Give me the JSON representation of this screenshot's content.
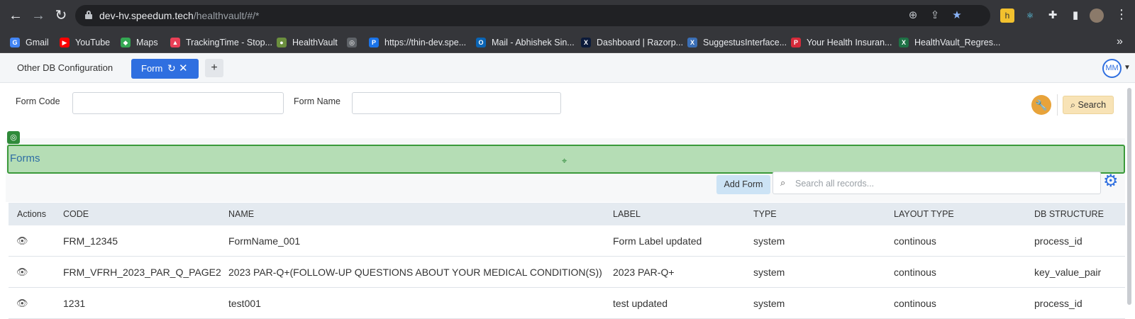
{
  "browser": {
    "url_host": "dev-hv.speedum.tech",
    "url_path": "/healthvault/#/*",
    "bookmarks": [
      {
        "label": "Gmail",
        "color": "#4285f4",
        "glyph": "G"
      },
      {
        "label": "YouTube",
        "color": "#ff0000",
        "glyph": "▶"
      },
      {
        "label": "Maps",
        "color": "#34a853",
        "glyph": "◆"
      },
      {
        "label": "TrackingTime - Stop...",
        "color": "#e94057",
        "glyph": "▲"
      },
      {
        "label": "HealthVault",
        "color": "#6b8f3e",
        "glyph": "●"
      },
      {
        "label": "",
        "color": "#5f6368",
        "glyph": "◎"
      },
      {
        "label": "https://thin-dev.spe...",
        "color": "#1a73e8",
        "glyph": "P"
      },
      {
        "label": "Mail - Abhishek Sin...",
        "color": "#0a64b4",
        "glyph": "O"
      },
      {
        "label": "Dashboard | Razorp...",
        "color": "#0b1a3a",
        "glyph": "X"
      },
      {
        "label": "SuggestusInterface...",
        "color": "#3b6fb6",
        "glyph": "X"
      },
      {
        "label": "Your Health Insuran...",
        "color": "#d62b3a",
        "glyph": "P"
      },
      {
        "label": "HealthVault_Regres...",
        "color": "#1e7145",
        "glyph": "X"
      }
    ]
  },
  "header": {
    "tab_other": "Other DB Configuration",
    "tab_active": "Form",
    "add_tab": "+",
    "avatar_initials": "MM"
  },
  "filters": {
    "form_code_label": "Form Code",
    "form_name_label": "Form Name",
    "search_button": "Search"
  },
  "section": {
    "title": "Forms",
    "add_button": "Add Form",
    "search_placeholder": "Search all records..."
  },
  "table": {
    "columns": [
      "Actions",
      "CODE",
      "NAME",
      "LABEL",
      "TYPE",
      "LAYOUT TYPE",
      "DB STRUCTURE"
    ],
    "rows": [
      {
        "code": "FRM_12345",
        "name": "FormName_001",
        "label": "Form Label updated",
        "type": "system",
        "layout_type": "continous",
        "db_structure": "process_id"
      },
      {
        "code": "FRM_VFRH_2023_PAR_Q_PAGE2",
        "name": "2023 PAR-Q+(FOLLOW-UP QUESTIONS ABOUT YOUR MEDICAL CONDITION(S))",
        "label": "2023 PAR-Q+",
        "type": "system",
        "layout_type": "continous",
        "db_structure": "key_value_pair"
      },
      {
        "code": "1231",
        "name": "test001",
        "label": "test updated",
        "type": "system",
        "layout_type": "continous",
        "db_structure": "process_id"
      }
    ]
  },
  "colors": {
    "accent": "#2f6fe0",
    "banner_bg": "#b5ddb5",
    "banner_border": "#3b9a3b",
    "wrench": "#e8a33a"
  }
}
